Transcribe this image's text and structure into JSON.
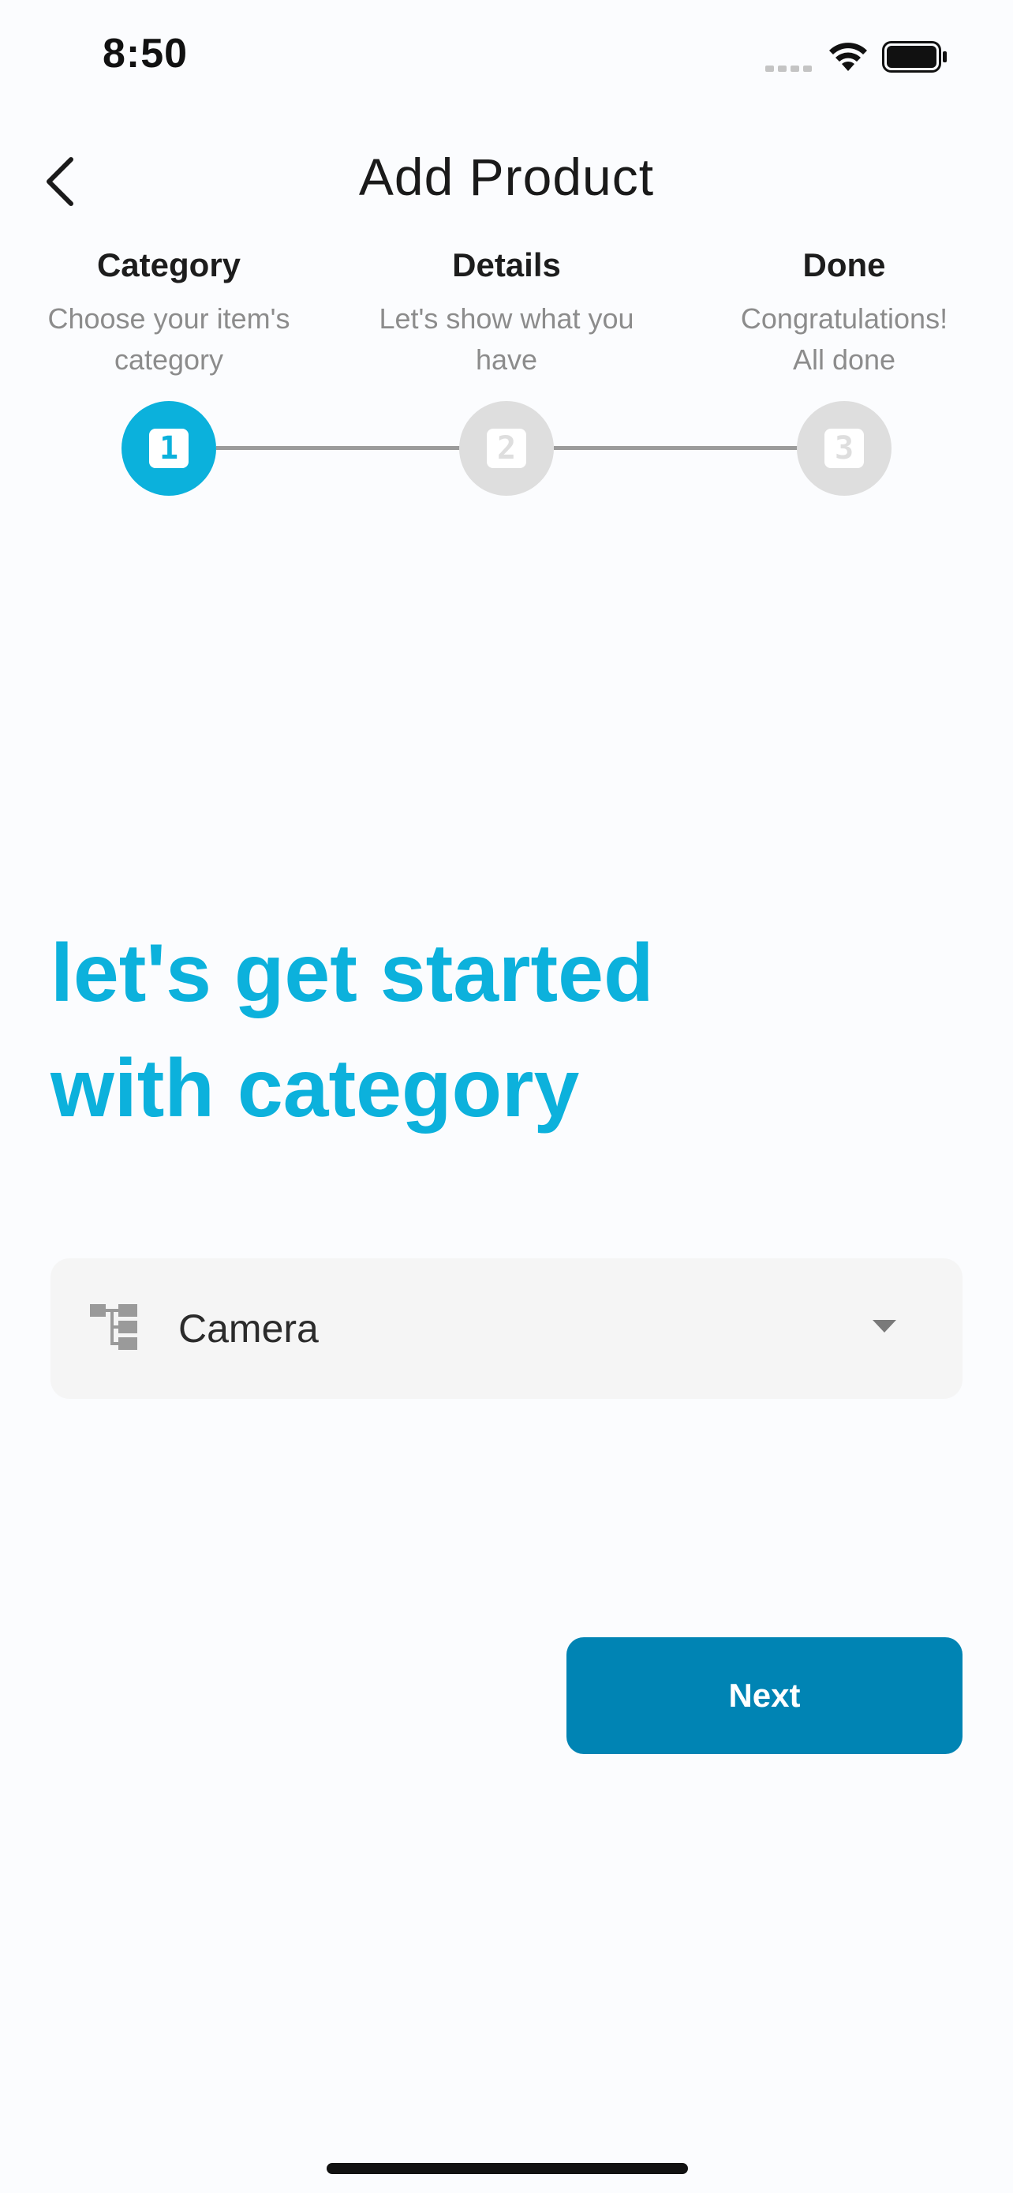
{
  "status_bar": {
    "time": "8:50"
  },
  "header": {
    "title": "Add Product",
    "back_icon": "chevron-left-icon"
  },
  "steps": [
    {
      "title": "Category",
      "subtitle_line1": "Choose your item's",
      "subtitle_line2": "category",
      "number": "1",
      "state": "active"
    },
    {
      "title": "Details",
      "subtitle_line1": "Let's show what you",
      "subtitle_line2": "have",
      "number": "2",
      "state": "inactive"
    },
    {
      "title": "Done",
      "subtitle_line1": "Congratulations!",
      "subtitle_line2": "All done",
      "number": "3",
      "state": "inactive"
    }
  ],
  "main": {
    "headline_line1": "let's get started",
    "headline_line2": "with category",
    "category_select": {
      "value": "Camera",
      "icon": "category-tree-icon",
      "dropdown_icon": "caret-down-icon"
    },
    "next_label": "Next"
  },
  "colors": {
    "accent": "#0BB1DC",
    "button": "#0084B4",
    "inactive_step": "#DEDEDE",
    "background": "#FBFCFE"
  }
}
